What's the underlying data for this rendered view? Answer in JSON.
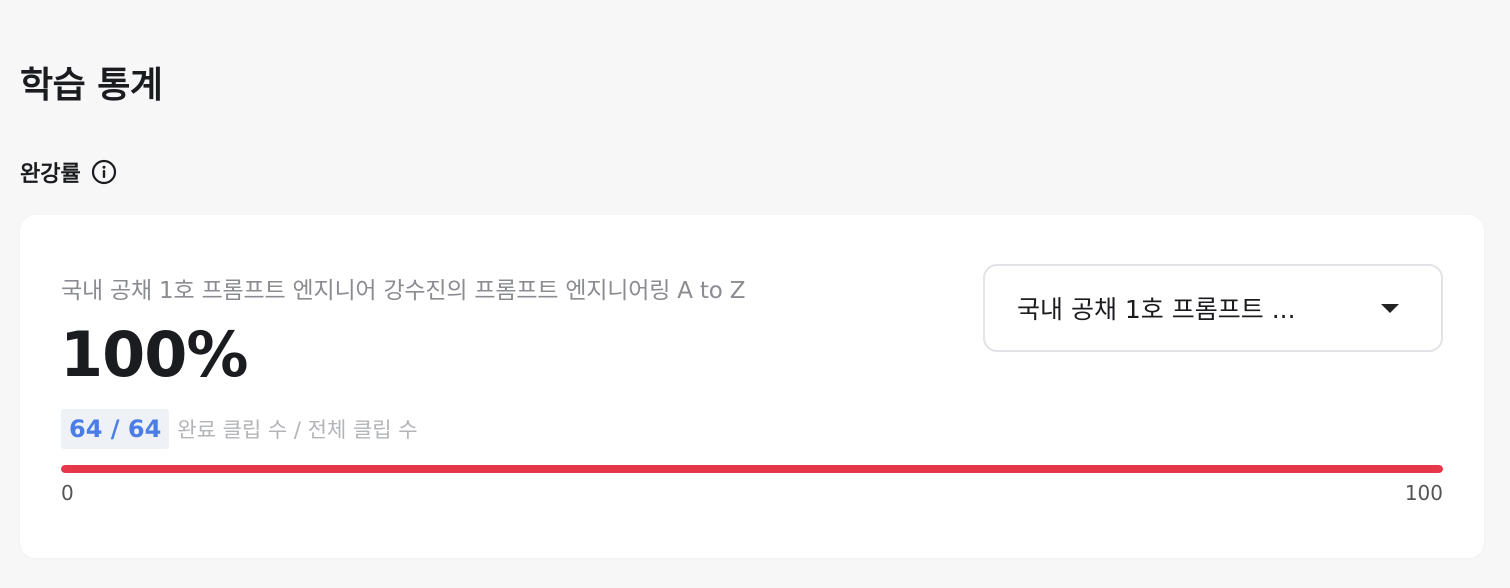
{
  "header": {
    "title": "학습 통계"
  },
  "section": {
    "title": "완강률",
    "info_icon": "info-circle-icon"
  },
  "card": {
    "course_name": "국내 공채 1호 프롬프트 엔지니어 강수진의 프롬프트 엔지니어링 A to Z",
    "completion_rate": "100%",
    "completed_count": "64 / 64",
    "count_description": "완료 클립 수 / 전체 클립 수",
    "progress": {
      "value": 100,
      "min_label": "0",
      "max_label": "100",
      "color": "#e5364a"
    },
    "course_select": {
      "value": "국내 공채 1호 프롬프트 ...",
      "icon": "caret-down-icon"
    }
  }
}
